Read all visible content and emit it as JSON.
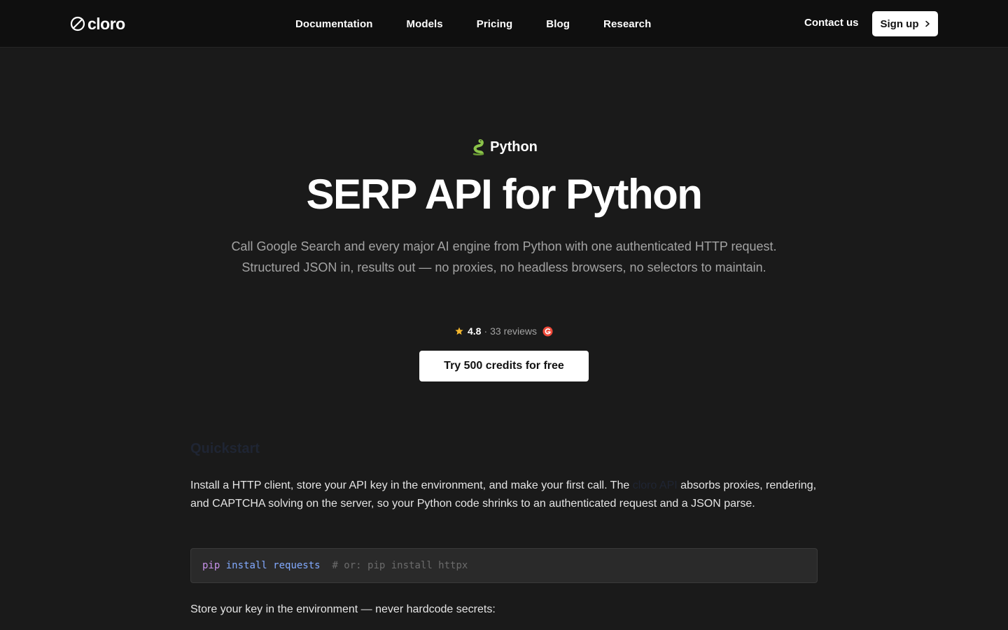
{
  "nav": {
    "logo_text": "cloro",
    "links": [
      "Documentation",
      "Models",
      "Pricing",
      "Blog",
      "Research"
    ],
    "contact": "Contact us",
    "signup": "Sign up"
  },
  "hero": {
    "eyebrow": "Python",
    "title": "SERP API for Python",
    "subtitle": "Call Google Search and every major AI engine from Python with one authenticated HTTP request. Structured JSON in, results out — no proxies, no headless browsers, no selectors to maintain.",
    "rating": {
      "value": "4.8",
      "separator": "·",
      "reviews": "33 reviews"
    },
    "cta": "Try 500 credits for free"
  },
  "content": {
    "section_heading": "Quickstart",
    "para1_before": "Install a HTTP client, store your API key in the environment, and make your first call. The ",
    "para1_link": "cloro API",
    "para1_after": " absorbs proxies, rendering, and CAPTCHA solving on the server, so your Python code shrinks to an authenticated request and a JSON parse.",
    "code": {
      "pip": "pip",
      "cmd": "install requests",
      "comment": "# or: pip install httpx"
    },
    "para2": "Store your key in the environment — never hardcode secrets:"
  },
  "colors": {
    "background": "#1a1a1a",
    "navbar": "#0f0f0f",
    "code_bg": "#2a2a2a",
    "muted_text": "#a3a3a3",
    "star": "#f5b82e",
    "g2": "#ef4a3a"
  }
}
